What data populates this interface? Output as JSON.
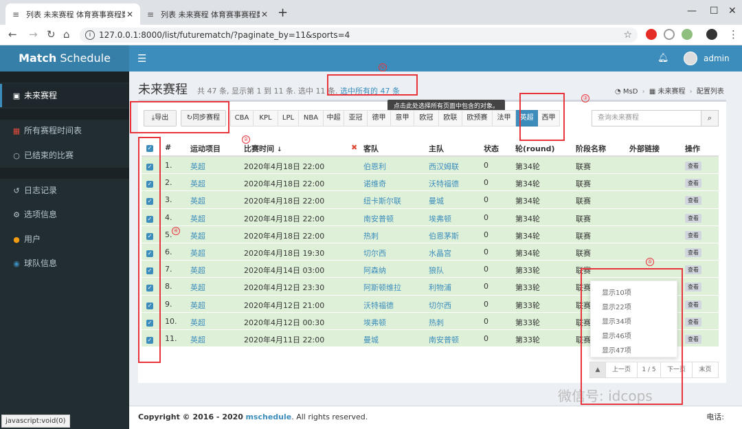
{
  "browser": {
    "tabs": [
      {
        "title": "列表 未来赛程 体育赛事赛程数据",
        "active": true
      },
      {
        "title": "列表 未来赛程 体育赛事赛程数据",
        "active": false
      }
    ],
    "url": "127.0.0.1:8000/list/futurematch/?paginate_by=11&sports=4"
  },
  "app": {
    "logo_bold": "Match",
    "logo_rest": " Schedule",
    "username": "admin"
  },
  "sidebar": {
    "items": [
      {
        "label": "未来赛程",
        "icon": "calendar-check-icon",
        "active": true
      },
      {
        "label": "所有赛程时间表",
        "icon": "calendar-icon",
        "active": false
      },
      {
        "label": "已结束的比赛",
        "icon": "circle-icon",
        "active": false
      },
      {
        "label": "日志记录",
        "icon": "history-icon",
        "active": false
      },
      {
        "label": "选项信息",
        "icon": "cogs-icon",
        "active": false
      },
      {
        "label": "用户",
        "icon": "user-icon",
        "active": false
      },
      {
        "label": "球队信息",
        "icon": "football-icon",
        "active": false
      }
    ]
  },
  "page": {
    "title": "未来赛程",
    "subtitle_prefix": "共 47 条, 显示第 1 到 11 条. 选中 11 条.",
    "select_all_link": "选中所有的 47 条",
    "breadcrumbs": [
      "MsD",
      "未来赛程",
      "配置列表"
    ],
    "tooltip": "点击此处选择所有页面中包含的对象。"
  },
  "toolbar": {
    "export_label": "导出",
    "sync_label": "同步赛程",
    "filters": [
      "CBA",
      "KPL",
      "LPL",
      "NBA",
      "中超",
      "亚冠",
      "德甲",
      "意甲",
      "欧冠",
      "欧联",
      "欧预赛",
      "法甲",
      "英超",
      "西甲"
    ],
    "active_filter": "英超",
    "search_placeholder": "查询未来赛程"
  },
  "table": {
    "headers": [
      "#",
      "运动项目",
      "比赛时间",
      "客队",
      "主队",
      "状态",
      "轮(round)",
      "阶段名称",
      "外部链接",
      "操作"
    ],
    "view_label": "查看",
    "rows": [
      {
        "n": "1.",
        "sport": "英超",
        "time": "2020年4月18日 22:00",
        "away": "伯恩利",
        "home": "西汉姆联",
        "status": "0",
        "round": "第34轮",
        "stage": "联赛"
      },
      {
        "n": "2.",
        "sport": "英超",
        "time": "2020年4月18日 22:00",
        "away": "诺维奇",
        "home": "沃特福德",
        "status": "0",
        "round": "第34轮",
        "stage": "联赛"
      },
      {
        "n": "3.",
        "sport": "英超",
        "time": "2020年4月18日 22:00",
        "away": "纽卡斯尔联",
        "home": "曼城",
        "status": "0",
        "round": "第34轮",
        "stage": "联赛"
      },
      {
        "n": "4.",
        "sport": "英超",
        "time": "2020年4月18日 22:00",
        "away": "南安普顿",
        "home": "埃弗顿",
        "status": "0",
        "round": "第34轮",
        "stage": "联赛"
      },
      {
        "n": "5.",
        "sport": "英超",
        "time": "2020年4月18日 22:00",
        "away": "热刺",
        "home": "伯恩茅斯",
        "status": "0",
        "round": "第34轮",
        "stage": "联赛"
      },
      {
        "n": "6.",
        "sport": "英超",
        "time": "2020年4月18日 19:30",
        "away": "切尔西",
        "home": "水晶宫",
        "status": "0",
        "round": "第34轮",
        "stage": "联赛"
      },
      {
        "n": "7.",
        "sport": "英超",
        "time": "2020年4月14日 03:00",
        "away": "阿森纳",
        "home": "狼队",
        "status": "0",
        "round": "第33轮",
        "stage": "联赛"
      },
      {
        "n": "8.",
        "sport": "英超",
        "time": "2020年4月12日 23:30",
        "away": "阿斯顿维拉",
        "home": "利物浦",
        "status": "0",
        "round": "第33轮",
        "stage": "联赛"
      },
      {
        "n": "9.",
        "sport": "英超",
        "time": "2020年4月12日 21:00",
        "away": "沃特福德",
        "home": "切尔西",
        "status": "0",
        "round": "第33轮",
        "stage": "联赛"
      },
      {
        "n": "10.",
        "sport": "英超",
        "time": "2020年4月12日 00:30",
        "away": "埃弗顿",
        "home": "热刺",
        "status": "0",
        "round": "第33轮",
        "stage": "联赛"
      },
      {
        "n": "11.",
        "sport": "英超",
        "time": "2020年4月11日 22:00",
        "away": "曼城",
        "home": "南安普顿",
        "status": "0",
        "round": "第33轮",
        "stage": "联赛"
      }
    ]
  },
  "pagination": {
    "page_size_options": [
      "显示10项",
      "显示22项",
      "显示34项",
      "显示46项",
      "显示47项"
    ],
    "prev_label": "上一页",
    "page_indicator": "1 / 5",
    "next_label": "下一页",
    "last_label": "末页"
  },
  "footer": {
    "copyright_prefix": "Copyright © 2016 - 2020",
    "brand": "mschedule",
    "suffix": ". All rights reserved.",
    "right": "电话:"
  },
  "status_bar": "javascript:void(0)",
  "watermark": "微信号: idcops",
  "annotations": [
    "①",
    "②",
    "③",
    "④",
    "⑤"
  ]
}
